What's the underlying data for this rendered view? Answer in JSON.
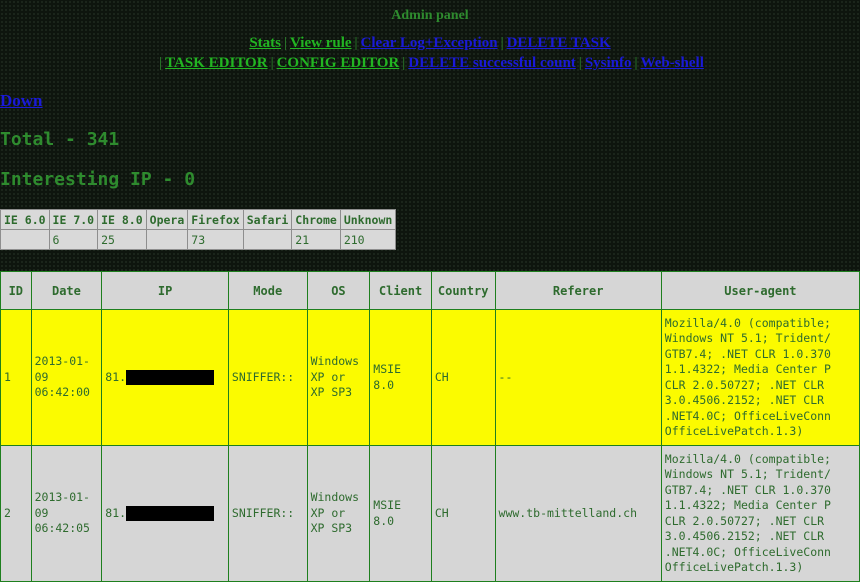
{
  "page_title": "Admin panel",
  "nav_row1": [
    {
      "label": "Stats",
      "color": "green"
    },
    {
      "label": "View rule",
      "color": "green"
    },
    {
      "label": "Clear Log+Exception",
      "color": "blue"
    },
    {
      "label": "DELETE TASK",
      "color": "blue"
    }
  ],
  "nav_row2": [
    {
      "label": "TASK EDITOR",
      "color": "green"
    },
    {
      "label": "CONFIG EDITOR",
      "color": "green"
    },
    {
      "label": "DELETE successful count",
      "color": "blue"
    },
    {
      "label": "Sysinfo",
      "color": "blue"
    },
    {
      "label": "Web-shell",
      "color": "blue"
    }
  ],
  "separator": "|",
  "down_link": "Down",
  "total_text": "Total - 341",
  "interesting_text": "Interesting IP - 0",
  "browser_table": {
    "headers": [
      "IE 6.0",
      "IE 7.0",
      "IE 8.0",
      "Opera",
      "Firefox",
      "Safari",
      "Chrome",
      "Unknown"
    ],
    "values": [
      "",
      "6",
      "25",
      "",
      "73",
      "",
      "21",
      "210"
    ]
  },
  "main_table": {
    "headers": [
      "ID",
      "Date",
      "IP",
      "Mode",
      "OS",
      "Client",
      "Country",
      "Referer",
      "User-agent"
    ],
    "rows": [
      {
        "highlight": true,
        "id": "1",
        "date": "2013-01-\n09\n06:42:00",
        "ip_prefix": "81.",
        "mode": "SNIFFER::",
        "os": "Windows\nXP or\nXP SP3",
        "client": "MSIE\n8.0",
        "country": "CH",
        "referer": "--",
        "user_agent": "Mozilla/4.0 (compatible;\nWindows NT 5.1; Trident/\nGTB7.4; .NET CLR 1.0.370\n1.1.4322; Media Center P\nCLR 2.0.50727; .NET CLR\n3.0.4506.2152; .NET CLR\n.NET4.0C; OfficeLiveConn\nOfficeLivePatch.1.3)"
      },
      {
        "highlight": false,
        "id": "2",
        "date": "2013-01-\n09\n06:42:05",
        "ip_prefix": "81.",
        "mode": "SNIFFER::",
        "os": "Windows\nXP or\nXP SP3",
        "client": "MSIE\n8.0",
        "country": "CH",
        "referer": "www.tb-mittelland.ch",
        "user_agent": "Mozilla/4.0 (compatible;\nWindows NT 5.1; Trident/\nGTB7.4; .NET CLR 1.0.370\n1.1.4322; Media Center P\nCLR 2.0.50727; .NET CLR\n3.0.4506.2152; .NET CLR\n.NET4.0C; OfficeLiveConn\nOfficeLivePatch.1.3)"
      }
    ]
  },
  "colors": {
    "background": "#0e150e",
    "link_green": "#22b522",
    "link_blue": "#1a1ad8",
    "text_green": "#2e8b2e",
    "highlight_row": "#fbfb00",
    "table_gray": "#d6d6d6"
  }
}
